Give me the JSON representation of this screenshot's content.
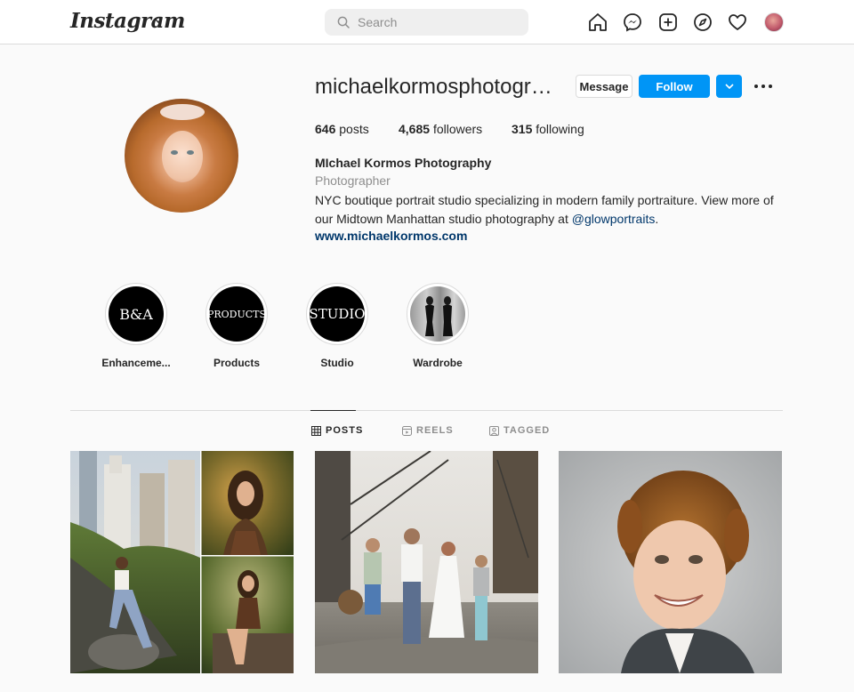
{
  "nav": {
    "logo": "Instagram",
    "search_placeholder": "Search",
    "icons": [
      "home-icon",
      "messenger-icon",
      "new-post-icon",
      "explore-icon",
      "activity-icon",
      "profile-avatar"
    ]
  },
  "profile": {
    "username": "michaelkormosphotogra...",
    "message_label": "Message",
    "follow_label": "Follow",
    "posts_count": "646",
    "posts_label": "posts",
    "followers_count": "4,685",
    "followers_label": "followers",
    "following_count": "315",
    "following_label": "following",
    "full_name": "MIchael Kormos Photography",
    "category": "Photographer",
    "bio_text": "NYC boutique portrait studio specializing in modern family portraiture. View more of our Midtown Manhattan studio photography at ",
    "bio_mention": "@glowportraits",
    "bio_end": ".",
    "website": "www.michaelkormos.com"
  },
  "highlights": [
    {
      "label": "Enhanceme...",
      "cover_text": "B&A"
    },
    {
      "label": "Products",
      "cover_text": "PRODUCTS"
    },
    {
      "label": "Studio",
      "cover_text": "STUDIO"
    },
    {
      "label": "Wardrobe",
      "cover_text": ""
    }
  ],
  "tabs": [
    {
      "label": "POSTS",
      "active": true
    },
    {
      "label": "REELS",
      "active": false
    },
    {
      "label": "TAGGED",
      "active": false
    }
  ],
  "colors": {
    "accent": "#0095f6",
    "link": "#00376b",
    "text": "#262626",
    "muted": "#8e8e8e",
    "border": "#dbdbdb",
    "background": "#fafafa"
  }
}
